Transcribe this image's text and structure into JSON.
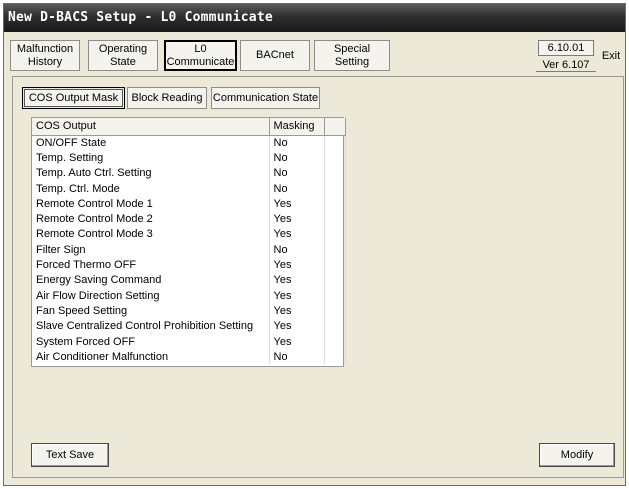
{
  "window": {
    "title": "New D-BACS Setup - L0 Communicate"
  },
  "nav": {
    "malfunction_history": [
      "Malfunction",
      "History"
    ],
    "operating_state": [
      "Operating",
      "State"
    ],
    "l0_communicate": [
      "L0",
      "Communicate"
    ],
    "bacnet": "BACnet",
    "special_setting": [
      "Special",
      "Setting"
    ]
  },
  "version": {
    "number": "6.10.01",
    "label": "Ver 6.107",
    "exit_label": "Exit"
  },
  "tabs": [
    "COS Output Mask",
    "Block Reading",
    "Communication State"
  ],
  "table": {
    "headers": [
      "COS Output",
      "Masking"
    ],
    "rows": [
      [
        "ON/OFF State",
        "No"
      ],
      [
        "Temp. Setting",
        "No"
      ],
      [
        "Temp. Auto Ctrl. Setting",
        "No"
      ],
      [
        "Temp. Ctrl. Mode",
        "No"
      ],
      [
        "Remote Control Mode 1",
        "Yes"
      ],
      [
        "Remote Control Mode 2",
        "Yes"
      ],
      [
        "Remote Control Mode 3",
        "Yes"
      ],
      [
        "Filter Sign",
        "No"
      ],
      [
        "Forced Thermo OFF",
        "Yes"
      ],
      [
        "Energy Saving Command",
        "Yes"
      ],
      [
        "Air Flow Direction Setting",
        "Yes"
      ],
      [
        "Fan Speed Setting",
        "Yes"
      ],
      [
        "Slave Centralized Control Prohibition Setting",
        "Yes"
      ],
      [
        "System Forced OFF",
        "Yes"
      ],
      [
        "Air Conditioner Malfunction",
        "No"
      ]
    ]
  },
  "buttons": {
    "text_save": "Text Save",
    "modify": "Modify"
  }
}
